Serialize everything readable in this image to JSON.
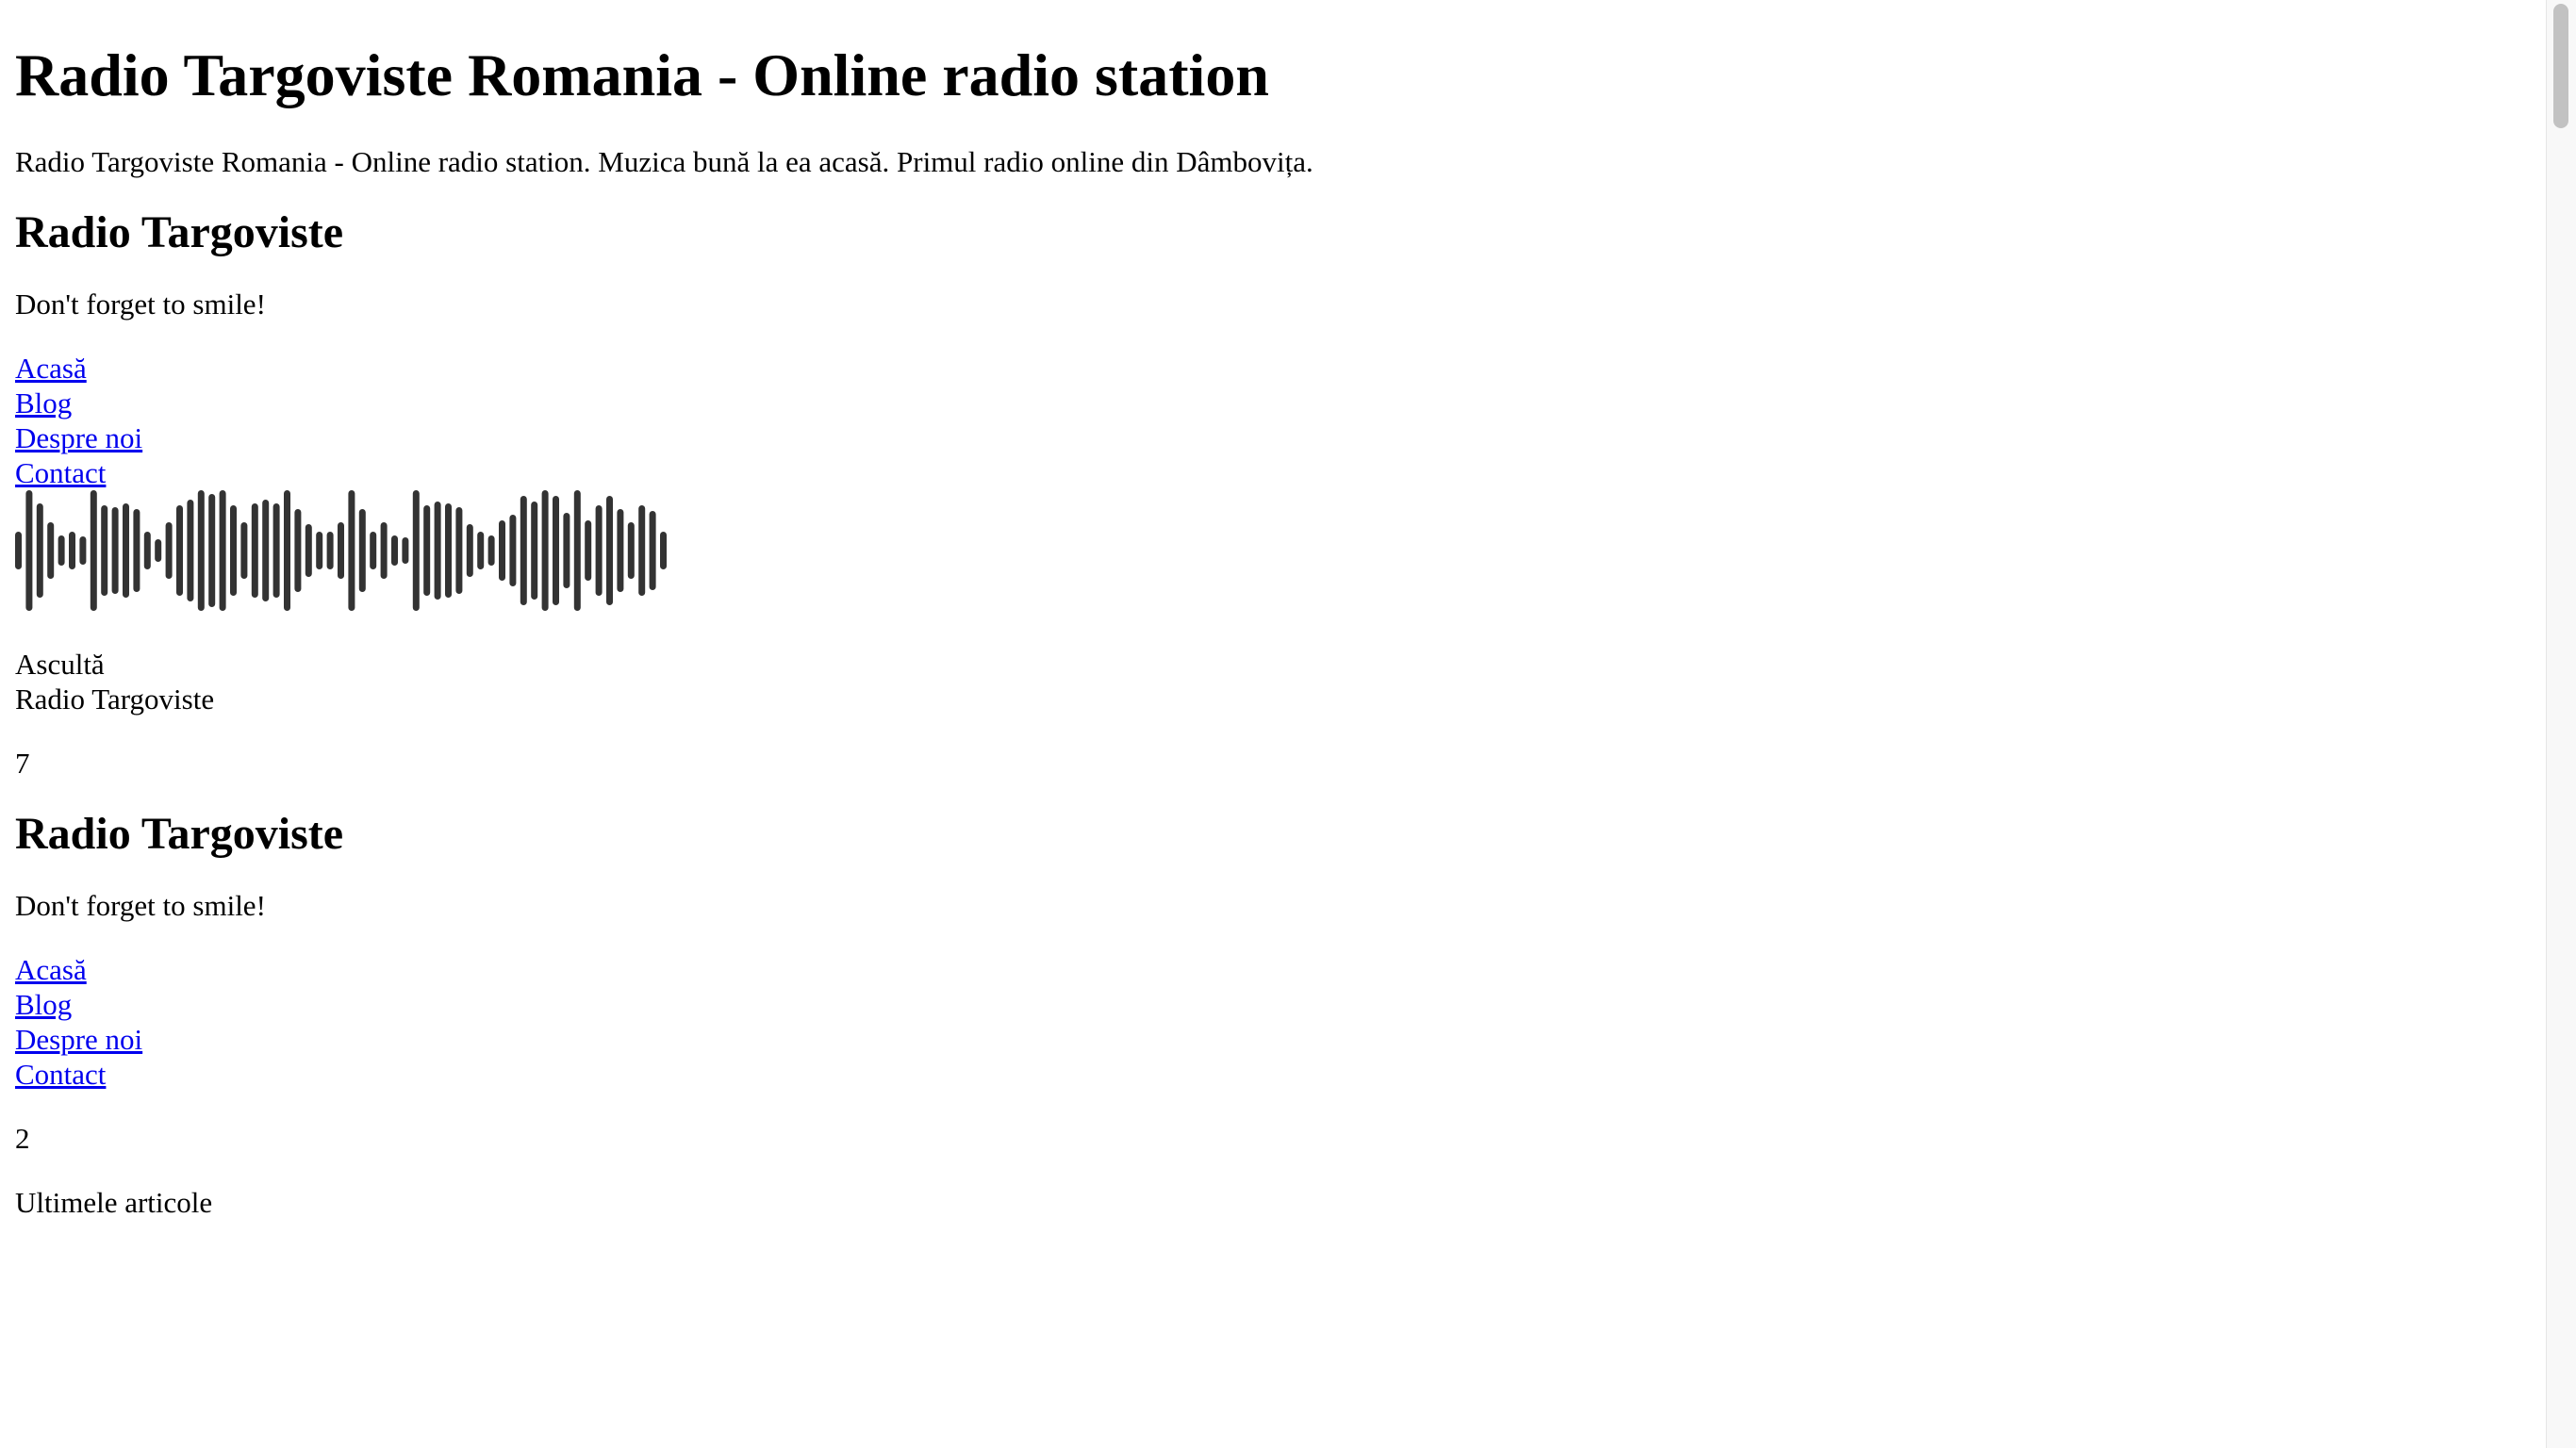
{
  "site": {
    "title": "Radio Targoviste Romania - Online radio station",
    "description": "Radio Targoviste Romania - Online radio station. Muzica bună la ea acasă. Primul radio online din Dâmbovița."
  },
  "section1": {
    "heading": "Radio Targoviste",
    "tagline": "Don't forget to smile!",
    "nav": [
      "Acasă",
      "Blog",
      "Despre noi",
      "Contact"
    ]
  },
  "player": {
    "waveform_icon": "audio-waveform-icon",
    "listen_label": "Ascultă",
    "station_name": "Radio Targoviste",
    "count": "7"
  },
  "section2": {
    "heading": "Radio Targoviste",
    "tagline": "Don't forget to smile!",
    "nav": [
      "Acasă",
      "Blog",
      "Despre noi",
      "Contact"
    ],
    "count": "2",
    "latest_label": "Ultimele articole"
  },
  "colors": {
    "link": "#0000ee",
    "text": "#000000",
    "waveform": "#333333",
    "background": "#ffffff"
  }
}
